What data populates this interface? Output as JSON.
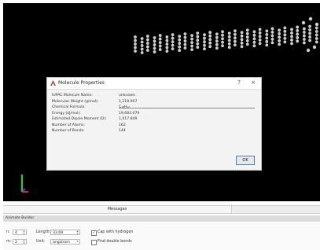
{
  "dialog": {
    "title": "Molecule Properties",
    "help_glyph": "?",
    "close_glyph": "×",
    "ok_label": "OK",
    "properties": [
      {
        "label": "IUPAC Molecule Name:",
        "value": "unknown"
      },
      {
        "label": "Molecular Weight (g/mol):",
        "value": "1,218.907"
      },
      {
        "label": "Chemical Formula:",
        "value": "C₁₀H₁₂"
      },
      {
        "label": "Energy (kJ/mol):",
        "value": "19,683.079"
      },
      {
        "label": "Estimated Dipole Moment (D):",
        "value": "1,017.849"
      },
      {
        "label": "Number of Atoms:",
        "value": "162"
      },
      {
        "label": "Number of Bonds:",
        "value": "144"
      }
    ]
  },
  "messages_tab": "Messages",
  "panel_title": "Animate Builder",
  "controls": {
    "row1": {
      "prefix": "n:",
      "spin1": "4",
      "length_label": "Length:",
      "length_value": "33.69",
      "check_label": "Cap with hydrogen",
      "checked": true
    },
    "row2": {
      "prefix": "m:",
      "spin1": "2",
      "unit_label": "Unit:",
      "unit_value": "angstrom",
      "check_label": "Find double bonds",
      "checked": false
    }
  },
  "colors": {
    "viewport_bg": "#000000",
    "atom": "#cfcfcf",
    "bond": "#9a9a9a",
    "axis_y": "#27d027",
    "axis_x": "#e33030",
    "axis_z": "#3a5cff"
  }
}
